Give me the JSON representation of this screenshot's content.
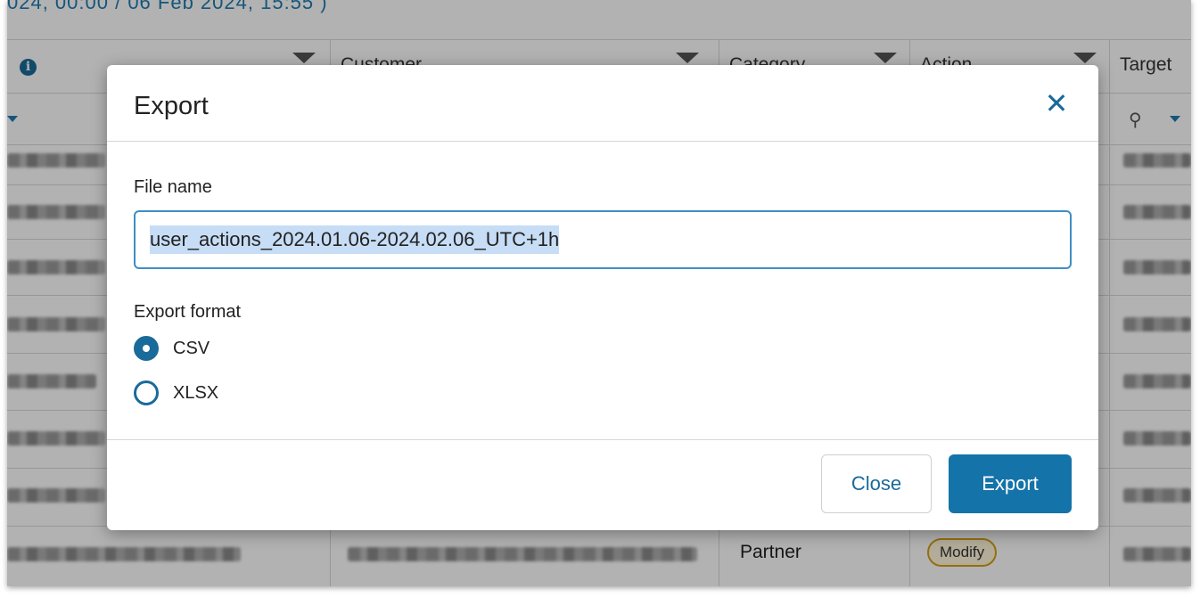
{
  "background_table": {
    "date_range_link": "024, 00:00 / 06 Feb 2024, 15:55 )",
    "columns": [
      "",
      "Customer",
      "Category",
      "Action",
      "Target"
    ],
    "last_row": {
      "category": "Partner",
      "action_badge": "Modify"
    }
  },
  "dialog": {
    "title": "Export",
    "close_icon": "close-icon",
    "file_name_label": "File name",
    "file_name_value": "user_actions_2024.01.06-2024.02.06_UTC+1h",
    "format_label": "Export format",
    "formats": [
      {
        "label": "CSV",
        "checked": true
      },
      {
        "label": "XLSX",
        "checked": false
      }
    ],
    "close_button": "Close",
    "export_button": "Export"
  },
  "colors": {
    "primary": "#1473a8",
    "accent": "#1a6a9a",
    "input_border": "#3d8fc2",
    "selection": "#c7ddf6",
    "badge_border": "#d4a017"
  }
}
